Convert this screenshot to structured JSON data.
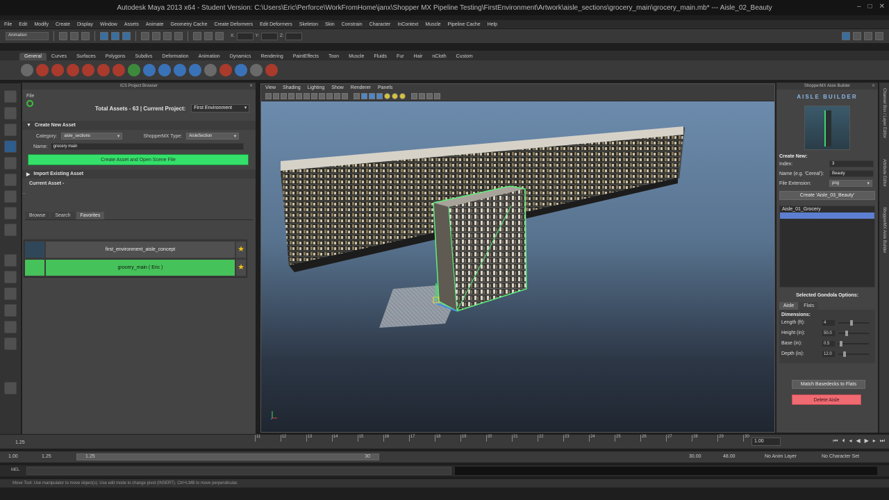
{
  "titlebar": {
    "title": "Autodesk Maya 2013 x64 - Student Version: C:\\Users\\Eric\\Perforce\\WorkFromHome\\janx\\Shopper MX Pipeline Testing\\FirstEnvironment\\Artwork\\aisle_sections\\grocery_main\\grocery_main.mb* --- Aisle_02_Beauty"
  },
  "menubar": [
    "File",
    "Edit",
    "Modify",
    "Create",
    "Display",
    "Window",
    "Assets",
    "Animate",
    "Geometry Cache",
    "Create Deformers",
    "Edit Deformers",
    "Skeleton",
    "Skin",
    "Constrain",
    "Character",
    "InContext",
    "Muscle",
    "Pipeline Cache",
    "Help"
  ],
  "statusline": {
    "mode": "Animation",
    "x_label": "X:",
    "y_label": "Y:",
    "z_label": "Z:"
  },
  "shelf_tabs": [
    "General",
    "Curves",
    "Surfaces",
    "Polygons",
    "Subdivs",
    "Deformation",
    "Animation",
    "Dynamics",
    "Rendering",
    "PaintEffects",
    "Toon",
    "Muscle",
    "Fluids",
    "Fur",
    "Hair",
    "nCloth",
    "Custom"
  ],
  "left_panel": {
    "header": "ICS Project Browser",
    "file_menu": "File",
    "totals_label": "Total Assets - 63  |  Current Project:",
    "current_project": "First Environment",
    "create_section": "Create New Asset",
    "category_label": "Category:",
    "category_value": "aisle_sections",
    "type_label": "ShopperMX Type:",
    "type_value": "AisleSection",
    "name_label": "Name:",
    "name_value": "grocery main",
    "create_button": "Create Asset and Open Scene File",
    "import_section": "Import Existing Asset",
    "current_asset_label": "Current Asset -",
    "current_asset_value": "--",
    "tabs": [
      "Browse",
      "Search",
      "Favorites"
    ],
    "favorites": [
      {
        "label": "first_environment_aisle_concept",
        "starred": true
      },
      {
        "label": "grocery_main ( Eric )",
        "starred": true
      }
    ]
  },
  "viewport": {
    "menus": [
      "View",
      "Shading",
      "Lighting",
      "Show",
      "Renderer",
      "Panels"
    ]
  },
  "right_panel": {
    "header": "ShopperMX Aisle Builder",
    "logo": "AISLE BUILDER",
    "create_new_label": "Create New:",
    "index_label": "Index:",
    "index_value": "3",
    "name_label": "Name (e.g. 'Cereal'):",
    "name_value": "Beauty",
    "ext_label": "File Extension:",
    "ext_value": "png",
    "create_button": "Create 'Aisle_03_Beauty'",
    "aisles": [
      "Aisle_01_Grocery",
      "Aisle_02_Beauty"
    ],
    "selected_aisle_index": 1,
    "gondola_title": "Selected Gondola Options:",
    "gondola_tabs": [
      "Aisle",
      "Flats"
    ],
    "dimensions_label": "Dimensions:",
    "dimensions": [
      {
        "label": "Length (ft):",
        "value": "4",
        "level": 0.42
      },
      {
        "label": "Height (in):",
        "value": "50.0",
        "level": 0.25
      },
      {
        "label": "Base (in):",
        "value": "0.5",
        "level": 0.05
      },
      {
        "label": "Depth (in):",
        "value": "12.0",
        "level": 0.18
      }
    ],
    "match_button": "Match Basedecks to Flats",
    "delete_button": "Delete Aisle"
  },
  "side_tabs": [
    "Channel Box / Layer Editor",
    "Attribute Editor",
    "ShopperMX Aisle Builder"
  ],
  "timeline": {
    "left_value": "1.25",
    "ticks": [
      "11",
      "12",
      "13",
      "14",
      "15",
      "16",
      "17",
      "18",
      "19",
      "20",
      "21",
      "22",
      "23",
      "24",
      "25",
      "26",
      "27",
      "28",
      "29",
      "30"
    ],
    "current_frame": "1.00"
  },
  "range": {
    "start": "1.00",
    "playback_start": "1.25",
    "slider_start": "1.25",
    "slider_end": "30",
    "playback_end": "30.00",
    "end": "48.00",
    "anim_layer": "No Anim Layer",
    "character_set": "No Character Set"
  },
  "command_line": {
    "label": "MEL"
  },
  "help_line": "Move Tool: Use manipulator to move object(s). Use edit mode to change pivot (INSERT). Ctrl+LMB to move perpendicular."
}
